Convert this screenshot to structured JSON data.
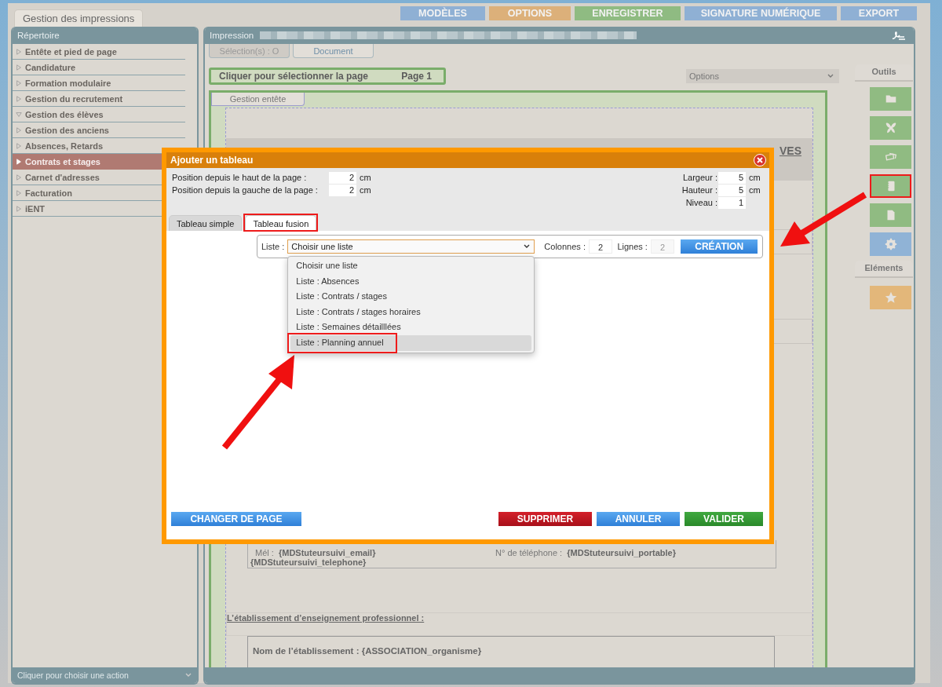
{
  "app_tab": {
    "label": "Gestion des impressions"
  },
  "top_buttons": [
    {
      "label": "MODÈLES",
      "color": "#8fb0d4"
    },
    {
      "label": "OPTIONS",
      "color": "#dcb07a"
    },
    {
      "label": "ENREGISTRER",
      "color": "#8fbb82"
    },
    {
      "label": "SIGNATURE NUMÉRIQUE",
      "color": "#8fb0d4"
    },
    {
      "label": "EXPORT",
      "color": "#8fb0d4"
    }
  ],
  "sidebar": {
    "title": "Répertoire",
    "items": [
      {
        "label": "Entête et pied de page",
        "expanded": false,
        "selected": false
      },
      {
        "label": "Candidature",
        "expanded": false,
        "selected": false
      },
      {
        "label": "Formation modulaire",
        "expanded": false,
        "selected": false
      },
      {
        "label": "Gestion du recrutement",
        "expanded": false,
        "selected": false
      },
      {
        "label": "Gestion des élèves",
        "expanded": true,
        "selected": false
      },
      {
        "label": "Gestion des anciens",
        "expanded": false,
        "selected": false
      },
      {
        "label": "Absences, Retards",
        "expanded": false,
        "selected": false
      },
      {
        "label": "Contrats et stages",
        "expanded": false,
        "selected": true
      },
      {
        "label": "Carnet d'adresses",
        "expanded": false,
        "selected": false
      },
      {
        "label": "Facturation",
        "expanded": false,
        "selected": false
      },
      {
        "label": "iENT",
        "expanded": false,
        "selected": false
      }
    ],
    "footer": "Cliquer pour choisir une action"
  },
  "main": {
    "title": "Impression",
    "buttons": [
      {
        "label": "Sélection(s) : O",
        "disabled": true
      },
      {
        "label": "Document",
        "disabled": false
      }
    ],
    "page_bar": {
      "label": "Cliquer pour sélectionner la page",
      "page": "Page 1"
    },
    "options_select": {
      "value": "Options"
    },
    "page_tab": "Gestion entête",
    "heading_fragment": "VES",
    "contact_lines": [
      {
        "label": "Mél :",
        "value": "{MDStuteursuivi_email}"
      },
      {
        "label": "N° de téléphone :",
        "value": "{MDStuteursuivi_portable}"
      }
    ],
    "contact_extra": "{MDStuteursuivi_telephone}",
    "section_title": "L’établissement d’enseignement professionnel :",
    "institution_line": "Nom de l’établissement : {ASSOCIATION_organisme}"
  },
  "tools": {
    "title": "Outils",
    "buttons": [
      {
        "kind": "folder",
        "highlighted": false
      },
      {
        "kind": "butterfly",
        "highlighted": false
      },
      {
        "kind": "cards",
        "highlighted": false
      },
      {
        "kind": "notebook",
        "highlighted": true
      },
      {
        "kind": "document",
        "highlighted": false
      },
      {
        "kind": "gear",
        "highlighted": false
      }
    ],
    "elements_title": "Eléments",
    "element_buttons": [
      {
        "kind": "star",
        "highlighted": false
      }
    ]
  },
  "dialog": {
    "title": "Ajouter un tableau",
    "position_fields": [
      {
        "label": "Position depuis le haut de la page :",
        "value": "2",
        "unit": "cm"
      },
      {
        "label": "Position depuis la gauche de la page :",
        "value": "2",
        "unit": "cm"
      }
    ],
    "size_fields": [
      {
        "label": "Largeur :",
        "value": "5",
        "unit": "cm"
      },
      {
        "label": "Hauteur :",
        "value": "5",
        "unit": "cm"
      },
      {
        "label": "Niveau :",
        "value": "1"
      }
    ],
    "tabs": [
      {
        "label": "Tableau simple",
        "selected": false,
        "highlighted": false
      },
      {
        "label": "Tableau fusion",
        "selected": true,
        "highlighted": true
      }
    ],
    "list_label": "Liste :",
    "list_select": {
      "value": "Choisir une liste",
      "expanded": true
    },
    "list_options": [
      {
        "label": "Choisir une liste",
        "selected": false,
        "highlighted": false
      },
      {
        "label": "Liste : Absences",
        "selected": false,
        "highlighted": false
      },
      {
        "label": "Liste : Contrats / stages",
        "selected": false,
        "highlighted": false
      },
      {
        "label": "Liste : Contrats / stages horaires",
        "selected": false,
        "highlighted": false
      },
      {
        "label": "Liste : Semaines détailllées",
        "selected": false,
        "highlighted": false
      },
      {
        "label": "Liste : Planning annuel",
        "selected": true,
        "highlighted": true
      }
    ],
    "columns": {
      "label": "Colonnes :",
      "value": "2",
      "disabled": false
    },
    "rows": {
      "label": "Lignes :",
      "value": "2",
      "disabled": true
    },
    "create_button": "CRÉATION",
    "left_buttons": [
      {
        "label": "CHANGER DE PAGE",
        "kind": "primary"
      }
    ],
    "right_buttons": [
      {
        "label": "SUPPRIMER",
        "kind": "danger"
      },
      {
        "label": "ANNULER",
        "kind": "primary"
      },
      {
        "label": "VALIDER",
        "kind": "success"
      }
    ]
  }
}
